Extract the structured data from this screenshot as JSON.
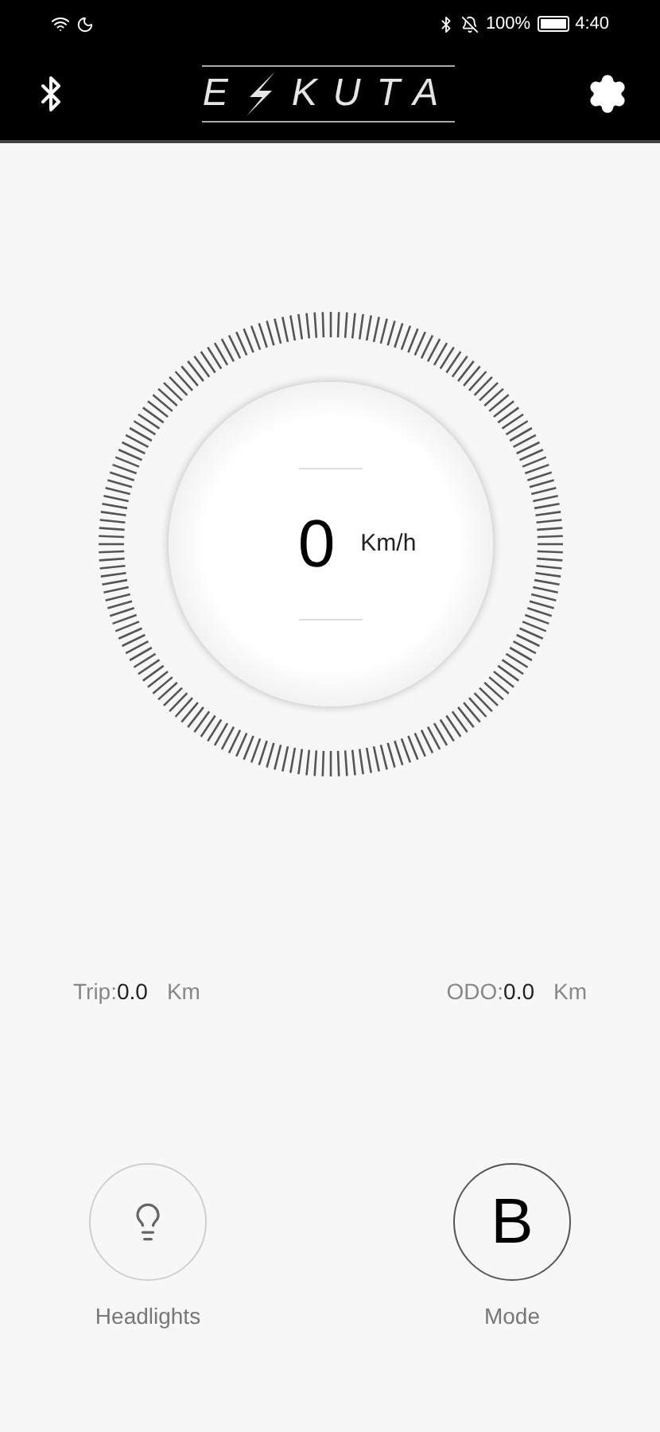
{
  "status_bar": {
    "battery": "100%",
    "time": "4:40"
  },
  "header": {
    "logo": {
      "left": "E",
      "right": "KUTA"
    }
  },
  "speed": {
    "value": "0",
    "unit": "Km/h"
  },
  "stats": [
    {
      "label": "Trip:",
      "value": "0.0",
      "unit": "Km"
    },
    {
      "label": "ODO:",
      "value": "0.0",
      "unit": "Km"
    }
  ],
  "controls": [
    {
      "kind": "light",
      "label": "Headlights",
      "on": false
    },
    {
      "kind": "mode",
      "label": "Mode",
      "value": "B"
    }
  ]
}
